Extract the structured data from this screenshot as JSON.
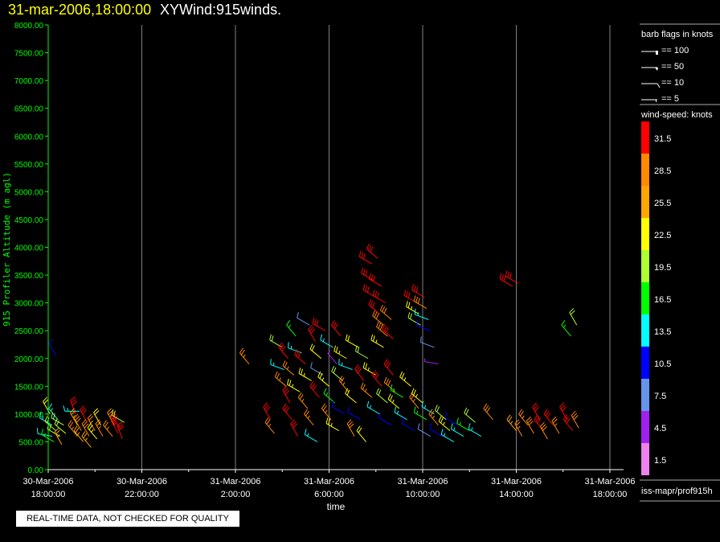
{
  "header": {
    "date": "31-mar-2006,18:00:00",
    "title": "XYWind:915winds."
  },
  "footer": {
    "notice": "REAL-TIME DATA, NOT CHECKED FOR QUALITY"
  },
  "legend": {
    "barb_title": "barb flags in knots",
    "barb_entries": [
      "== 100",
      "== 50",
      "== 10",
      "== 5"
    ],
    "colorbar_title": "wind-speed: knots",
    "colorbar": [
      {
        "label": "31.5",
        "color": "#ff0000"
      },
      {
        "label": "28.5",
        "color": "#ff8800"
      },
      {
        "label": "25.5",
        "color": "#ffa500"
      },
      {
        "label": "22.5",
        "color": "#ffff00"
      },
      {
        "label": "19.5",
        "color": "#adff2f"
      },
      {
        "label": "16.5",
        "color": "#00ff00"
      },
      {
        "label": "13.5",
        "color": "#00ffff"
      },
      {
        "label": "10.5",
        "color": "#0000ff"
      },
      {
        "label": "7.5",
        "color": "#6495ed"
      },
      {
        "label": "4.5",
        "color": "#a020f0"
      },
      {
        "label": "1.5",
        "color": "#ee82ee"
      }
    ],
    "source": "iss-mapr/prof915h"
  },
  "chart_data": {
    "type": "scatter",
    "subtype": "wind-barb",
    "xlabel": "time",
    "ylabel": "915 Profiler Altitude (m agl)",
    "xlim": [
      "30-Mar 18:00",
      "31-Mar 18:00"
    ],
    "ylim": [
      0,
      8000
    ],
    "yticks": [
      "0.00",
      "500.00",
      "1000.00",
      "1500.00",
      "2000.00",
      "2500.00",
      "3000.00",
      "3500.00",
      "4000.00",
      "4500.00",
      "5000.00",
      "5500.00",
      "6000.00",
      "6500.00",
      "7000.00",
      "7500.00",
      "8000.00"
    ],
    "xticks": [
      {
        "date": "30-Mar-2006",
        "time": "18:00:00"
      },
      {
        "date": "30-Mar-2006",
        "time": "22:00:00"
      },
      {
        "date": "31-Mar-2006",
        "time": "2:00:00"
      },
      {
        "date": "31-Mar-2006",
        "time": "6:00:00"
      },
      {
        "date": "31-Mar-2006",
        "time": "10:00:00"
      },
      {
        "date": "31-Mar-2006",
        "time": "14:00:00"
      },
      {
        "date": "31-Mar-2006",
        "time": "18:00:00"
      }
    ],
    "grid": "vertical",
    "barb_fields": [
      "time",
      "altitude_m",
      "speed_kt",
      "direction_deg"
    ],
    "barbs": [
      [
        "30-Mar 18:05",
        1000,
        21,
        330
      ],
      [
        "30-Mar 18:10",
        800,
        14,
        300
      ],
      [
        "30-Mar 18:10",
        600,
        12,
        280
      ],
      [
        "30-Mar 18:15",
        500,
        16,
        300
      ],
      [
        "30-Mar 18:20",
        700,
        19,
        310
      ],
      [
        "30-Mar 18:25",
        900,
        13,
        320
      ],
      [
        "30-Mar 18:30",
        600,
        20,
        300
      ],
      [
        "30-Mar 18:35",
        450,
        25,
        330
      ],
      [
        "30-Mar 18:40",
        800,
        18,
        300
      ],
      [
        "30-Mar 18:45",
        650,
        20,
        310
      ],
      [
        "30-Mar 18:20",
        2050,
        10,
        330
      ],
      [
        "30-Mar 19:20",
        1050,
        14,
        270
      ],
      [
        "30-Mar 19:10",
        1000,
        31,
        340
      ],
      [
        "30-Mar 19:15",
        800,
        26,
        330
      ],
      [
        "30-Mar 19:15",
        600,
        27,
        320
      ],
      [
        "30-Mar 19:25",
        700,
        28,
        330
      ],
      [
        "30-Mar 19:30",
        500,
        26,
        320
      ],
      [
        "30-Mar 19:40",
        850,
        31,
        330
      ],
      [
        "30-Mar 19:45",
        600,
        28,
        330
      ],
      [
        "30-Mar 19:50",
        400,
        26,
        320
      ],
      [
        "30-Mar 20:00",
        700,
        27,
        330
      ],
      [
        "30-Mar 20:05",
        550,
        23,
        320
      ],
      [
        "30-Mar 20:15",
        800,
        22,
        330
      ],
      [
        "30-Mar 20:20",
        600,
        27,
        330
      ],
      [
        "30-Mar 20:45",
        600,
        27,
        320
      ],
      [
        "30-Mar 20:50",
        800,
        28,
        330
      ],
      [
        "30-Mar 21:00",
        650,
        31,
        330
      ],
      [
        "30-Mar 21:05",
        750,
        31,
        320
      ],
      [
        "30-Mar 21:10",
        550,
        31,
        340
      ],
      [
        "30-Mar 21:15",
        850,
        19,
        300
      ],
      [
        "31-Mar 02:35",
        1900,
        27,
        320
      ],
      [
        "31-Mar 03:30",
        900,
        31,
        330
      ],
      [
        "31-Mar 03:40",
        650,
        27,
        320
      ],
      [
        "31-Mar 04:00",
        2200,
        19,
        300
      ],
      [
        "31-Mar 04:05",
        1800,
        14,
        290
      ],
      [
        "31-Mar 04:10",
        1500,
        27,
        310
      ],
      [
        "31-Mar 04:15",
        2000,
        31,
        320
      ],
      [
        "31-Mar 04:20",
        1200,
        31,
        330
      ],
      [
        "31-Mar 04:25",
        900,
        31,
        320
      ],
      [
        "31-Mar 04:30",
        1700,
        27,
        310
      ],
      [
        "31-Mar 04:35",
        2400,
        17,
        320
      ],
      [
        "31-Mar 04:40",
        600,
        31,
        330
      ],
      [
        "31-Mar 04:45",
        1400,
        23,
        300
      ],
      [
        "31-Mar 04:50",
        2100,
        14,
        290
      ],
      [
        "31-Mar 05:00",
        1900,
        31,
        310
      ],
      [
        "31-Mar 05:05",
        1100,
        27,
        320
      ],
      [
        "31-Mar 05:10",
        2600,
        8,
        300
      ],
      [
        "31-Mar 05:15",
        1600,
        23,
        300
      ],
      [
        "31-Mar 05:20",
        800,
        27,
        320
      ],
      [
        "31-Mar 05:25",
        2300,
        31,
        330
      ],
      [
        "31-Mar 05:30",
        500,
        14,
        300
      ],
      [
        "31-Mar 05:35",
        1300,
        31,
        320
      ],
      [
        "31-Mar 05:40",
        2000,
        22,
        310
      ],
      [
        "31-Mar 05:45",
        1700,
        8,
        300
      ],
      [
        "31-Mar 05:50",
        2500,
        31,
        300
      ],
      [
        "31-Mar 06:00",
        1500,
        23,
        310
      ],
      [
        "31-Mar 06:05",
        900,
        27,
        320
      ],
      [
        "31-Mar 06:10",
        2200,
        14,
        300
      ],
      [
        "31-Mar 06:15",
        1200,
        17,
        310
      ],
      [
        "31-Mar 06:20",
        1900,
        5,
        320
      ],
      [
        "31-Mar 06:25",
        700,
        23,
        300
      ],
      [
        "31-Mar 06:30",
        2400,
        31,
        320
      ],
      [
        "31-Mar 06:35",
        1600,
        20,
        310
      ],
      [
        "31-Mar 06:40",
        1000,
        11,
        300
      ],
      [
        "31-Mar 06:45",
        2000,
        23,
        300
      ],
      [
        "31-Mar 06:50",
        1400,
        27,
        320
      ],
      [
        "31-Mar 07:00",
        1800,
        14,
        290
      ],
      [
        "31-Mar 07:05",
        600,
        28,
        330
      ],
      [
        "31-Mar 07:10",
        1200,
        22,
        310
      ],
      [
        "31-Mar 07:15",
        2200,
        22,
        300
      ],
      [
        "31-Mar 07:20",
        900,
        11,
        300
      ],
      [
        "31-Mar 07:30",
        1600,
        31,
        320
      ],
      [
        "31-Mar 07:35",
        500,
        22,
        320
      ],
      [
        "31-Mar 07:40",
        2000,
        20,
        300
      ],
      [
        "31-Mar 07:50",
        1300,
        27,
        310
      ],
      [
        "31-Mar 08:00",
        1700,
        23,
        300
      ],
      [
        "31-Mar 08:10",
        1000,
        14,
        300
      ],
      [
        "31-Mar 08:15",
        1500,
        31,
        320
      ],
      [
        "31-Mar 08:20",
        2200,
        23,
        300
      ],
      [
        "31-Mar 08:30",
        1200,
        20,
        310
      ],
      [
        "31-Mar 08:40",
        800,
        11,
        300
      ],
      [
        "31-Mar 08:45",
        1700,
        31,
        320
      ],
      [
        "31-Mar 08:50",
        1400,
        28,
        310
      ],
      [
        "31-Mar 09:00",
        1100,
        23,
        310
      ],
      [
        "31-Mar 09:10",
        1300,
        17,
        300
      ],
      [
        "31-Mar 09:20",
        900,
        14,
        300
      ],
      [
        "31-Mar 09:30",
        1500,
        23,
        310
      ],
      [
        "31-Mar 09:40",
        700,
        11,
        300
      ],
      [
        "31-Mar 09:50",
        1100,
        27,
        320
      ],
      [
        "31-Mar 10:00",
        1200,
        23,
        310
      ],
      [
        "31-Mar 10:10",
        900,
        17,
        300
      ],
      [
        "31-Mar 10:20",
        600,
        8,
        300
      ],
      [
        "31-Mar 10:30",
        1000,
        14,
        300
      ],
      [
        "31-Mar 10:40",
        800,
        27,
        320
      ],
      [
        "31-Mar 10:50",
        600,
        11,
        300
      ],
      [
        "31-Mar 11:00",
        900,
        20,
        310
      ],
      [
        "31-Mar 11:10",
        700,
        23,
        310
      ],
      [
        "31-Mar 11:20",
        500,
        14,
        300
      ],
      [
        "31-Mar 11:30",
        800,
        11,
        300
      ],
      [
        "31-Mar 11:45",
        600,
        14,
        300
      ],
      [
        "31-Mar 12:00",
        700,
        17,
        300
      ],
      [
        "31-Mar 12:15",
        850,
        20,
        310
      ],
      [
        "31-Mar 12:30",
        600,
        14,
        300
      ],
      [
        "31-Mar 13:00",
        900,
        28,
        320
      ],
      [
        "31-Mar 07:50",
        3700,
        31,
        300
      ],
      [
        "31-Mar 07:55",
        3400,
        31,
        300
      ],
      [
        "31-Mar 08:00",
        3100,
        31,
        300
      ],
      [
        "31-Mar 08:05",
        3800,
        31,
        310
      ],
      [
        "31-Mar 08:10",
        2800,
        31,
        310
      ],
      [
        "31-Mar 08:15",
        3300,
        31,
        300
      ],
      [
        "31-Mar 08:20",
        2600,
        28,
        310
      ],
      [
        "31-Mar 08:25",
        3000,
        31,
        300
      ],
      [
        "31-Mar 08:30",
        2400,
        28,
        310
      ],
      [
        "31-Mar 08:40",
        2700,
        28,
        310
      ],
      [
        "31-Mar 08:45",
        2350,
        31,
        310
      ],
      [
        "31-Mar 09:45",
        3000,
        31,
        300
      ],
      [
        "31-Mar 09:50",
        2800,
        23,
        300
      ],
      [
        "31-Mar 09:55",
        2600,
        20,
        300
      ],
      [
        "31-Mar 10:05",
        3100,
        31,
        300
      ],
      [
        "31-Mar 10:10",
        2900,
        28,
        300
      ],
      [
        "31-Mar 10:15",
        2700,
        14,
        290
      ],
      [
        "31-Mar 10:20",
        2500,
        11,
        290
      ],
      [
        "31-Mar 10:30",
        2200,
        8,
        290
      ],
      [
        "31-Mar 10:40",
        1900,
        5,
        280
      ],
      [
        "31-Mar 13:50",
        3300,
        31,
        300
      ],
      [
        "31-Mar 14:05",
        3350,
        31,
        300
      ],
      [
        "31-Mar 14:00",
        700,
        26,
        320
      ],
      [
        "31-Mar 14:15",
        600,
        27,
        330
      ],
      [
        "31-Mar 14:30",
        800,
        27,
        320
      ],
      [
        "31-Mar 14:45",
        650,
        28,
        330
      ],
      [
        "31-Mar 15:00",
        900,
        31,
        330
      ],
      [
        "31-Mar 15:10",
        700,
        31,
        320
      ],
      [
        "31-Mar 15:20",
        550,
        28,
        330
      ],
      [
        "31-Mar 15:35",
        800,
        31,
        320
      ],
      [
        "31-Mar 15:50",
        650,
        27,
        330
      ],
      [
        "31-Mar 16:10",
        900,
        31,
        330
      ],
      [
        "31-Mar 16:25",
        700,
        31,
        320
      ],
      [
        "31-Mar 16:40",
        750,
        28,
        330
      ],
      [
        "31-Mar 16:20",
        2400,
        17,
        320
      ],
      [
        "31-Mar 16:35",
        2600,
        20,
        330
      ]
    ]
  },
  "colors": {
    "axis_y": "#00ff00",
    "axis_x": "#ffffff",
    "grid": "#808080",
    "date_title": "#ffff00"
  }
}
